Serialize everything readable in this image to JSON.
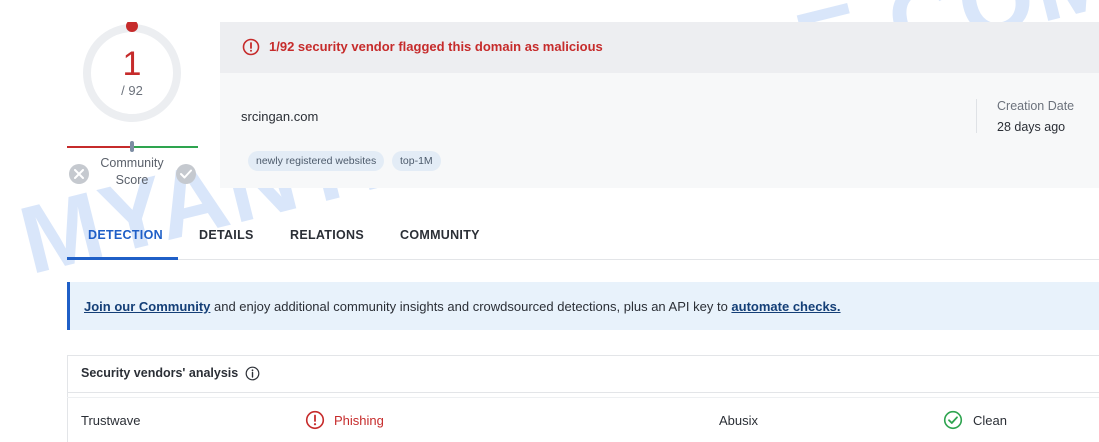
{
  "score": {
    "detections": "1",
    "total": "/ 92",
    "community_label_line1": "Community",
    "community_label_line2": "Score"
  },
  "alert": {
    "message": "1/92 security vendor flagged this domain as malicious",
    "icon": "alert-circle-icon",
    "color": "#c62b2b"
  },
  "domain": {
    "name": "srcingan.com",
    "tags": [
      "newly registered websites",
      "top-1M"
    ],
    "creation_date_label": "Creation Date",
    "creation_date_value": "28 days ago"
  },
  "tabs": [
    {
      "label": "DETECTION",
      "active": true
    },
    {
      "label": "DETAILS",
      "active": false
    },
    {
      "label": "RELATIONS",
      "active": false
    },
    {
      "label": "COMMUNITY",
      "active": false
    }
  ],
  "banner": {
    "link1": "Join our Community",
    "middle": " and enjoy additional community insights and crowdsourced detections, plus an API key to ",
    "link2": "automate checks."
  },
  "vendors": {
    "title": "Security vendors' analysis",
    "rows": [
      {
        "vendor": "Trustwave",
        "result": "Phishing",
        "result_icon": "alert-circle-icon",
        "vendor2": "Abusix",
        "result2": "Clean",
        "result2_icon": "check-circle-icon"
      }
    ]
  },
  "colors": {
    "accent": "#1f5fc7",
    "malicious": "#c62b2b",
    "clean": "#2ea44f"
  },
  "watermark": "MYANTISPYWARE.COM"
}
